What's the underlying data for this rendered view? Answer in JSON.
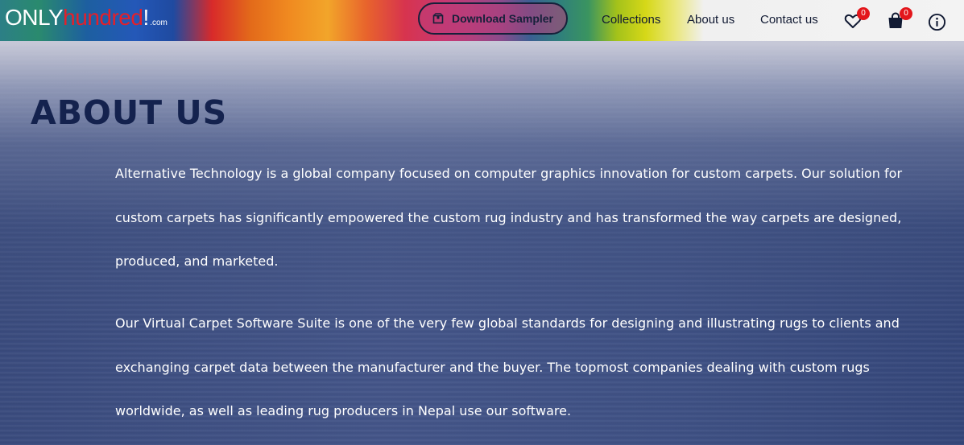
{
  "header": {
    "logo": {
      "part1": "ONLY",
      "part2": "hundred",
      "part3": "!",
      "suffix": ".com"
    },
    "sampler_button": {
      "label": "Download Sampler",
      "icon": "package-icon"
    },
    "nav": [
      {
        "label": "Collections"
      },
      {
        "label": "About us"
      },
      {
        "label": "Contact us"
      }
    ],
    "wishlist": {
      "icon": "heart-icon",
      "count": "0"
    },
    "cart": {
      "icon": "shopping-bag-icon",
      "count": "0"
    },
    "info": {
      "icon": "info-icon"
    }
  },
  "main": {
    "title": "ABOUT US",
    "paragraphs": [
      "Alternative Technology is a global company focused on computer graphics innovation for custom carpets. Our solution for custom carpets has significantly empowered the custom rug industry and has transformed the way carpets are designed, produced, and marketed.",
      "Our Virtual Carpet Software Suite is one of the very few global standards for designing and illustrating rugs to clients and exchanging carpet data between the manufacturer and the buyer. The topmost companies dealing with custom rugs worldwide, as well as leading rug producers in Nepal use our software."
    ]
  },
  "colors": {
    "title": "#14224e",
    "badge": "#e3161b",
    "logo_accent": "#e4202a",
    "nav_text": "#111a33"
  }
}
